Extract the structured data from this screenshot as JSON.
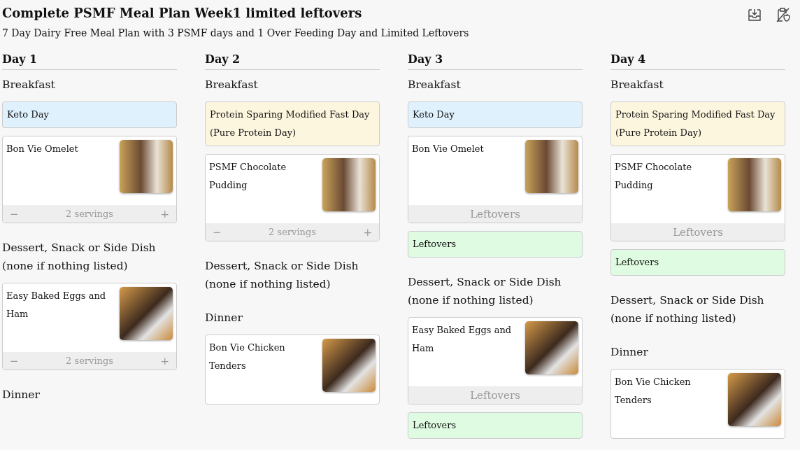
{
  "title": "Complete PSMF Meal Plan Week1 limited leftovers",
  "subtitle": "7 Day Dairy Free Meal Plan with 3 PSMF days and 1 Over Feeding Day and Limited Leftovers",
  "toolbar": [
    {
      "kind": "download"
    },
    {
      "kind": "no-food"
    }
  ],
  "days": [
    {
      "title": "Day 1",
      "sections": [
        {
          "heading": [
            "Breakfast"
          ],
          "items": [
            {
              "kind": "note",
              "lines": [
                "Keto Day"
              ],
              "color": "#dff1fd"
            },
            {
              "kind": "recipe",
              "name": "Bon Vie Omelet",
              "footer": {
                "kind": "servings",
                "minus": "−",
                "label": "2 servings",
                "plus": "+"
              }
            }
          ]
        },
        {
          "heading": [
            "Dessert, Snack or Side Dish",
            "(none if nothing listed)"
          ],
          "items": [
            {
              "kind": "recipe",
              "name": "Easy Baked Eggs and Ham",
              "footer": {
                "kind": "servings",
                "minus": "−",
                "label": "2 servings",
                "plus": "+"
              }
            }
          ]
        },
        {
          "heading": [
            "Dinner"
          ]
        }
      ]
    },
    {
      "title": "Day 2",
      "sections": [
        {
          "heading": [
            "Breakfast"
          ],
          "items": [
            {
              "kind": "note",
              "lines": [
                "Protein Sparing Modified Fast Day",
                "(Pure Protein Day)"
              ],
              "color": "#fdf6df"
            },
            {
              "kind": "recipe",
              "name": "PSMF Chocolate Pudding",
              "footer": {
                "kind": "servings",
                "minus": "−",
                "label": "2 servings",
                "plus": "+"
              }
            }
          ]
        },
        {
          "heading": [
            "Dessert, Snack or Side Dish",
            "(none if nothing listed)"
          ]
        },
        {
          "heading": [
            "Dinner"
          ],
          "items": [
            {
              "kind": "recipe",
              "name": "Bon Vie Chicken Tenders"
            }
          ]
        }
      ]
    },
    {
      "title": "Day 3",
      "sections": [
        {
          "heading": [
            "Breakfast"
          ],
          "items": [
            {
              "kind": "note",
              "lines": [
                "Keto Day"
              ],
              "color": "#dff1fd"
            },
            {
              "kind": "recipe",
              "name": "Bon Vie Omelet",
              "footer": {
                "kind": "leftovers",
                "label": "Leftovers"
              }
            },
            {
              "kind": "note",
              "lines": [
                "Leftovers"
              ],
              "color": "#dffbe1"
            }
          ]
        },
        {
          "heading": [
            "Dessert, Snack or Side Dish",
            "(none if nothing listed)"
          ],
          "items": [
            {
              "kind": "recipe",
              "name": "Easy Baked Eggs and Ham",
              "footer": {
                "kind": "leftovers",
                "label": "Leftovers"
              }
            },
            {
              "kind": "note",
              "lines": [
                "Leftovers"
              ],
              "color": "#dffbe1"
            }
          ]
        }
      ]
    },
    {
      "title": "Day 4",
      "sections": [
        {
          "heading": [
            "Breakfast"
          ],
          "items": [
            {
              "kind": "note",
              "lines": [
                "Protein Sparing Modified Fast Day",
                "(Pure Protein Day)"
              ],
              "color": "#fdf6df"
            },
            {
              "kind": "recipe",
              "name": "PSMF Chocolate Pudding",
              "footer": {
                "kind": "leftovers",
                "label": "Leftovers"
              }
            },
            {
              "kind": "note",
              "lines": [
                "Leftovers"
              ],
              "color": "#dffbe1"
            }
          ]
        },
        {
          "heading": [
            "Dessert, Snack or Side Dish",
            "(none if nothing listed)"
          ]
        },
        {
          "heading": [
            "Dinner"
          ],
          "items": [
            {
              "kind": "recipe",
              "name": "Bon Vie Chicken Tenders"
            }
          ]
        }
      ]
    }
  ]
}
